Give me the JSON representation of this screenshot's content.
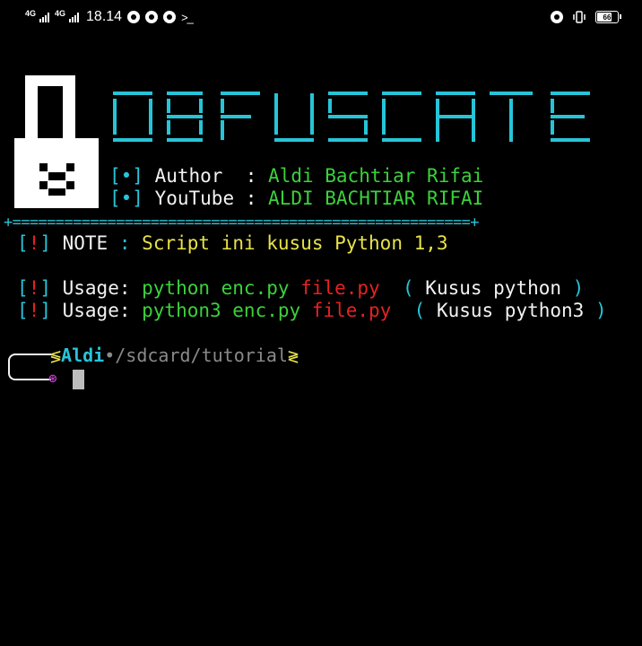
{
  "status_bar": {
    "network1": "4G",
    "network2": "4G",
    "time": "18.14",
    "battery": "66"
  },
  "banner": {
    "title": "OBFUSCATE",
    "author_bracket": "[•]",
    "author_label": "Author  :",
    "author_value": "Aldi Bachtiar Rifai",
    "youtube_bracket": "[•]",
    "youtube_label": "YouTube :",
    "youtube_value": "ALDI BACHTIAR RIFAI",
    "separator": "+=====================================================+"
  },
  "note": {
    "bracket_open": "[",
    "bang": "!",
    "bracket_close": "]",
    "label": "NOTE",
    "colon": ":",
    "text": "Script ini kusus Python 1,3"
  },
  "usage1": {
    "label": "Usage:",
    "command": "python enc.py",
    "file": "file.py",
    "paren_open": "(",
    "comment": "Kusus python",
    "paren_close": ")"
  },
  "usage2": {
    "label": "Usage:",
    "command": "python3 enc.py",
    "file": "file.py",
    "paren_open": "(",
    "comment": "Kusus python3",
    "paren_close": ")"
  },
  "prompt": {
    "open": "≶",
    "user": "Aldi",
    "dot": "•",
    "path": "/sdcard/tutorial",
    "close": "≷",
    "symbol": "⊛"
  },
  "colors": {
    "cyan": "#27c4d8",
    "green": "#3bd13b",
    "yellow": "#e8e24a",
    "red": "#e52222",
    "grey": "#8a8a8a"
  }
}
